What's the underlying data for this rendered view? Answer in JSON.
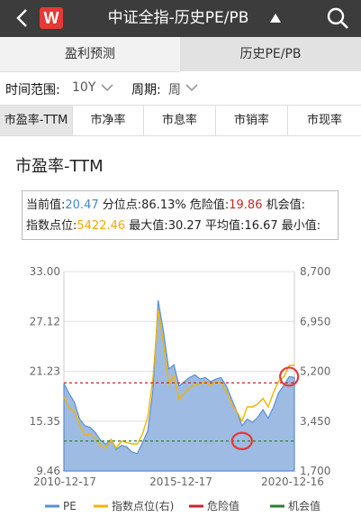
{
  "header": {
    "logo_text": "W",
    "title": "中证全指-历史PE/PB"
  },
  "tabs": [
    "盈利预测",
    "历史PE/PB"
  ],
  "filters": {
    "range_label": "时间范围:",
    "range_value": "10Y",
    "period_label": "周期:",
    "period_value": "周"
  },
  "metric_tabs": [
    "市盈率-TTM",
    "市净率",
    "市息率",
    "市销率",
    "市现率"
  ],
  "chart_title": "市盈率-TTM",
  "info": {
    "current_label": "当前值:",
    "current_value": "20.47",
    "percentile_label": "分位点:",
    "percentile_value": "86.13%",
    "danger_label": "危险值:",
    "danger_value": "19.86",
    "opportunity_label": "机会值:",
    "index_label": "指数点位:",
    "index_value": "5422.46",
    "max_label": "最大值:",
    "max_value": "30.27",
    "avg_label": "平均值:",
    "avg_value": "16.67",
    "min_label": "最小值:"
  },
  "colors": {
    "pe": "#5b8fd0",
    "index": "#f4b400",
    "danger": "#c62828",
    "opportunity": "#2e7d32"
  },
  "chart_data": {
    "type": "area",
    "left_ticks": [
      "33.00",
      "27.12",
      "21.23",
      "15.35",
      "9.46"
    ],
    "right_ticks": [
      "8,700",
      "6,950",
      "5,200",
      "3,450",
      "1,700"
    ],
    "x_ticks": [
      "2010-12-17",
      "2015-12-17",
      "2020-12-16"
    ],
    "y_left_range": [
      9.46,
      33.0
    ],
    "y_right_range": [
      1700,
      8700
    ],
    "danger_level": 19.86,
    "opportunity_level": 13.0,
    "legend": [
      "PE",
      "指数点位(右)",
      "危险值",
      "机会值"
    ],
    "x_dates": [
      "2010-12",
      "2011-03",
      "2011-06",
      "2011-09",
      "2011-12",
      "2012-03",
      "2012-06",
      "2012-09",
      "2012-12",
      "2013-03",
      "2013-06",
      "2013-09",
      "2013-12",
      "2014-03",
      "2014-06",
      "2014-09",
      "2014-12",
      "2015-03",
      "2015-05",
      "2015-06",
      "2015-08",
      "2015-11",
      "2016-01",
      "2016-03",
      "2016-06",
      "2016-09",
      "2016-12",
      "2017-03",
      "2017-06",
      "2017-09",
      "2017-12",
      "2018-03",
      "2018-06",
      "2018-09",
      "2018-12",
      "2019-03",
      "2019-06",
      "2019-09",
      "2019-12",
      "2020-03",
      "2020-06",
      "2020-09",
      "2020-12",
      "2021-02",
      "2021-04"
    ],
    "pe": [
      19.8,
      18.6,
      17.6,
      15.6,
      14.8,
      14.6,
      14.0,
      13.1,
      12.6,
      13.2,
      12.0,
      12.5,
      12.3,
      11.7,
      11.5,
      12.8,
      14.2,
      19.0,
      29.6,
      26.0,
      21.5,
      22.0,
      19.5,
      20.0,
      20.5,
      20.8,
      20.3,
      20.5,
      20.0,
      20.3,
      20.5,
      19.5,
      18.0,
      16.5,
      14.8,
      15.6,
      15.2,
      15.8,
      16.7,
      15.7,
      17.0,
      18.7,
      19.6,
      20.6,
      20.5
    ],
    "index": [
      4300,
      3900,
      3800,
      3300,
      2950,
      3000,
      2850,
      2600,
      2500,
      2800,
      2500,
      2750,
      2700,
      2650,
      2650,
      3000,
      3600,
      4950,
      7350,
      6200,
      4750,
      5050,
      4200,
      4450,
      4600,
      4750,
      4750,
      4850,
      4700,
      4850,
      4800,
      4500,
      4050,
      3800,
      3450,
      3950,
      3950,
      4050,
      4250,
      3950,
      4450,
      4850,
      5000,
      5400,
      5422
    ]
  }
}
